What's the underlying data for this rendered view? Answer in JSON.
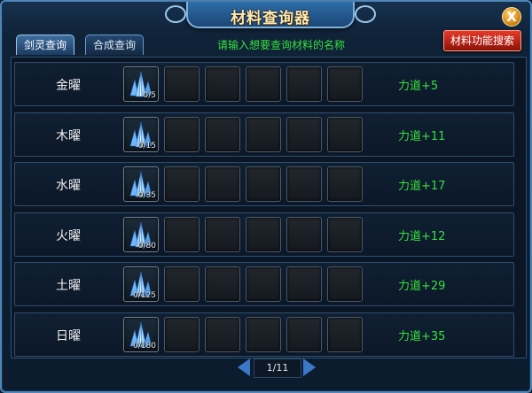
{
  "window": {
    "title": "材料查询器",
    "close_glyph": "X"
  },
  "tabs": [
    {
      "label": "剑灵查询",
      "active": true
    },
    {
      "label": "合成查询",
      "active": false
    }
  ],
  "hint": "请输入想要查询材料的名称",
  "search_button": "材料功能搜索",
  "rows": [
    {
      "name": "金曜",
      "item_icon": "crystal-icon",
      "count": "0/5",
      "bonus": "力道+5"
    },
    {
      "name": "木曜",
      "item_icon": "crystal-icon",
      "count": "0/15",
      "bonus": "力道+11"
    },
    {
      "name": "水曜",
      "item_icon": "crystal-icon",
      "count": "0/35",
      "bonus": "力道+17"
    },
    {
      "name": "火曜",
      "item_icon": "crystal-icon",
      "count": "0/80",
      "bonus": "力道+12"
    },
    {
      "name": "土曜",
      "item_icon": "crystal-icon",
      "count": "0/125",
      "bonus": "力道+29"
    },
    {
      "name": "日曜",
      "item_icon": "crystal-icon",
      "count": "0/180",
      "bonus": "力道+35"
    }
  ],
  "pager": {
    "text": "1/11"
  },
  "colors": {
    "accent_green": "#35e03b",
    "frame_blue": "#4f86b7",
    "button_red": "#c82a1a"
  }
}
